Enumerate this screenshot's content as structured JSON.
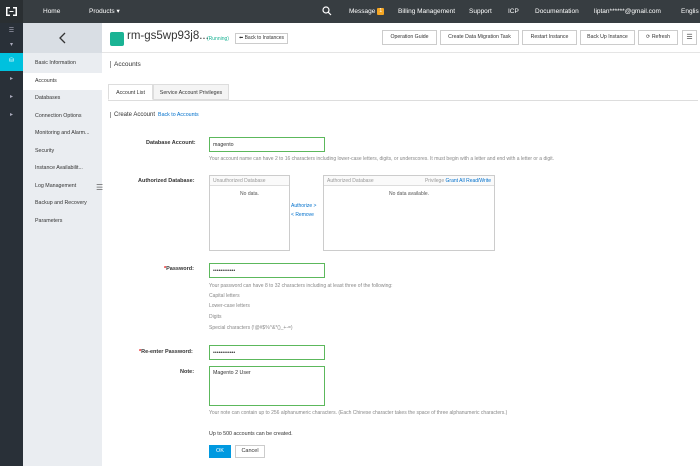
{
  "topbar": {
    "home": "Home",
    "products": "Products",
    "message": "Message",
    "message_count": "1",
    "billing": "Billing Management",
    "support": "Support",
    "icp": "ICP",
    "documentation": "Documentation",
    "user": "liptan******@gmail.com",
    "lang": "Englis"
  },
  "sidebar": {
    "items": [
      {
        "label": "Basic Information"
      },
      {
        "label": "Accounts"
      },
      {
        "label": "Databases"
      },
      {
        "label": "Connection Options"
      },
      {
        "label": "Monitoring and Alarm..."
      },
      {
        "label": "Security"
      },
      {
        "label": "Instance Availabilit..."
      },
      {
        "label": "Log Management"
      },
      {
        "label": "Backup and Recovery"
      },
      {
        "label": "Parameters"
      }
    ]
  },
  "header": {
    "instance_name": "rm-gs5wp93j8...",
    "status": "(Running)",
    "back_to_instances": "Back to Instances",
    "buttons": {
      "operation_guide": "Operation Guide",
      "migration": "Create Data Migration Task",
      "restart": "Restart Instance",
      "backup": "Back Up Instance",
      "refresh": "Refresh"
    }
  },
  "section_title": "Accounts",
  "tabs": [
    {
      "label": "Account List"
    },
    {
      "label": "Service Account Privileges"
    }
  ],
  "create_account": {
    "title": "Create Account",
    "back_link": "Back to Accounts"
  },
  "form": {
    "db_account_label": "Database Account:",
    "db_account_value": "magento",
    "db_account_hint": "Your account name can have 2 to 16 characters including lower-case letters, digits, or underscores. It must begin with a letter and end with a letter or a digit.",
    "authorized_db_label": "Authorized Database:",
    "unauthorized_header": "Unauthorized Database",
    "left_no_data": "No data.",
    "authorize": "Authorize",
    "remove": "Remove",
    "authorized_header": "Authorized Database",
    "privilege_label": "Privilege",
    "grant_all": "Grant All Read/Write",
    "right_no_data": "No data available.",
    "password_label": "Password:",
    "password_value": "••••••••••••",
    "password_hints": [
      "Your password can have 8 to 32 characters including at least three of the following:",
      "Capital letters",
      "Lower-case letters",
      "Digits",
      "Special characters (!@#$%^&*()_+-=)"
    ],
    "reenter_label": "Re-enter Password:",
    "reenter_value": "••••••••••••",
    "note_label": "Note:",
    "note_value": "Magento 2 User",
    "note_hint": "Your note can contain up to 256 alphanumeric characters. (Each Chinese character takes the space of three alphanumeric characters.)",
    "limit_text": "Up to 500 accounts can be created.",
    "ok": "OK",
    "cancel": "Cancel"
  }
}
